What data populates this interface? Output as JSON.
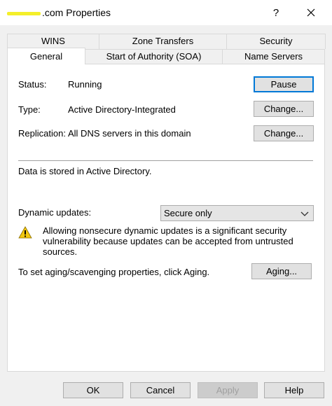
{
  "window": {
    "title_suffix": ".com Properties",
    "help_label": "?"
  },
  "tabs": {
    "back_row": [
      "WINS",
      "Zone Transfers",
      "Security"
    ],
    "front_row": [
      "General",
      "Start of Authority (SOA)",
      "Name Servers"
    ]
  },
  "general": {
    "status_label": "Status:",
    "status_value": "Running",
    "pause_button": "Pause",
    "type_label": "Type:",
    "type_value": "Active Directory-Integrated",
    "type_change_button": "Change...",
    "replication_label": "Replication:",
    "replication_value": "All DNS servers in this domain",
    "replication_change_button": "Change...",
    "storage_note": "Data is stored in Active Directory.",
    "dynamic_updates_label": "Dynamic updates:",
    "dynamic_updates_value": "Secure only",
    "warning_text": "Allowing nonsecure dynamic updates is a significant security vulnerability because updates can be accepted from untrusted sources.",
    "aging_text": "To set aging/scavenging properties, click Aging.",
    "aging_button": "Aging..."
  },
  "footer": {
    "ok": "OK",
    "cancel": "Cancel",
    "apply": "Apply",
    "help": "Help"
  },
  "colors": {
    "accent": "#0078d7",
    "warning": "#f2c811"
  }
}
